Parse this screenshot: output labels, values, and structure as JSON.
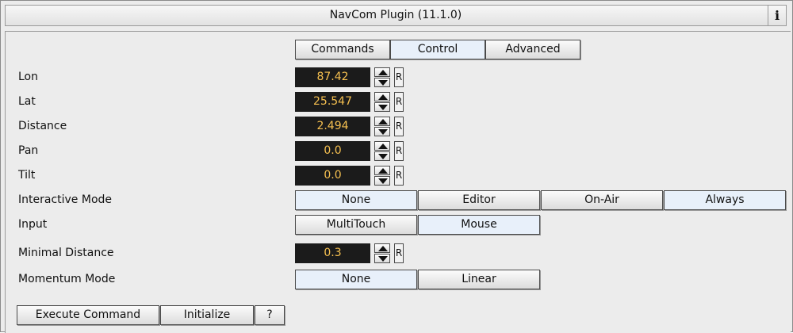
{
  "window": {
    "title": "NavCom Plugin (11.1.0)",
    "info_label": "i"
  },
  "tabs": [
    {
      "label": "Commands"
    },
    {
      "label": "Control"
    },
    {
      "label": "Advanced"
    }
  ],
  "fields": {
    "lon": {
      "label": "Lon",
      "value": "87.42",
      "reset": "R"
    },
    "lat": {
      "label": "Lat",
      "value": "25.547",
      "reset": "R"
    },
    "distance": {
      "label": "Distance",
      "value": "2.494",
      "reset": "R"
    },
    "pan": {
      "label": "Pan",
      "value": "0.0",
      "reset": "R"
    },
    "tilt": {
      "label": "Tilt",
      "value": "0.0",
      "reset": "R"
    },
    "minimal_distance": {
      "label": "Minimal Distance",
      "value": "0.3",
      "reset": "R"
    }
  },
  "interactive_mode": {
    "label": "Interactive Mode",
    "options": [
      "None",
      "Editor",
      "On-Air",
      "Always"
    ],
    "selected": "Always"
  },
  "input": {
    "label": "Input",
    "options": [
      "MultiTouch",
      "Mouse"
    ],
    "selected": "Mouse"
  },
  "momentum_mode": {
    "label": "Momentum Mode",
    "options": [
      "None",
      "Linear"
    ],
    "selected": "None"
  },
  "footer": {
    "execute_label": "Execute Command",
    "initialize_label": "Initialize",
    "help_label": "?"
  }
}
